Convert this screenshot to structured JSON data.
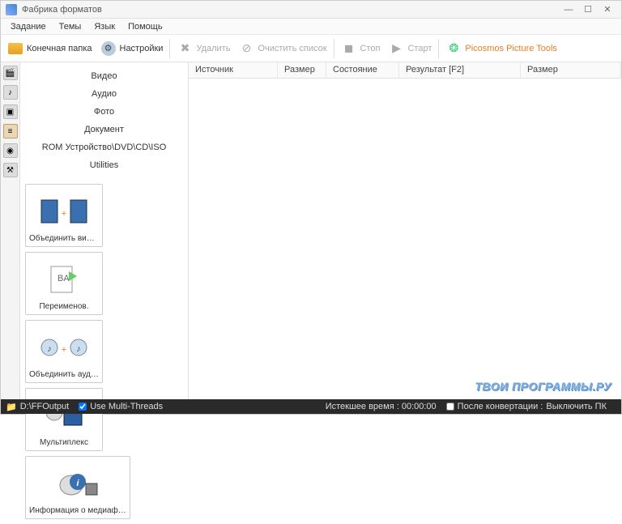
{
  "window": {
    "title": "Фабрика форматов"
  },
  "menu": [
    "Задание",
    "Темы",
    "Язык",
    "Помощь"
  ],
  "toolbar": {
    "output_folder": "Конечная папка",
    "settings": "Настройки",
    "delete": "Удалить",
    "clear_list": "Очистить список",
    "stop": "Стоп",
    "start": "Старт",
    "picosmos": "Picosmos Picture Tools"
  },
  "categories": [
    "Видео",
    "Аудио",
    "Фото",
    "Документ",
    "ROM Устройство\\DVD\\CD\\ISO",
    "Utilities"
  ],
  "utilities": [
    {
      "label": "Объединить видео"
    },
    {
      "label": "Переименов."
    },
    {
      "label": "Объединить аудио"
    },
    {
      "label": "Мультиплекс"
    },
    {
      "label": "Информация о медиафайле"
    }
  ],
  "table": {
    "headers": [
      "Источник",
      "Размер",
      "Состояние",
      "Результат [F2]",
      "Размер"
    ]
  },
  "status": {
    "output_path": "D:\\FFOutput",
    "multithread": "Use Multi-Threads",
    "elapsed": "Истекшее время : 00:00:00",
    "after_convert_checkbox": "После конвертации :",
    "after_convert_action": "Выключить ПК"
  },
  "watermark": "ТВОИ ПРОГРАММЫ.РУ"
}
